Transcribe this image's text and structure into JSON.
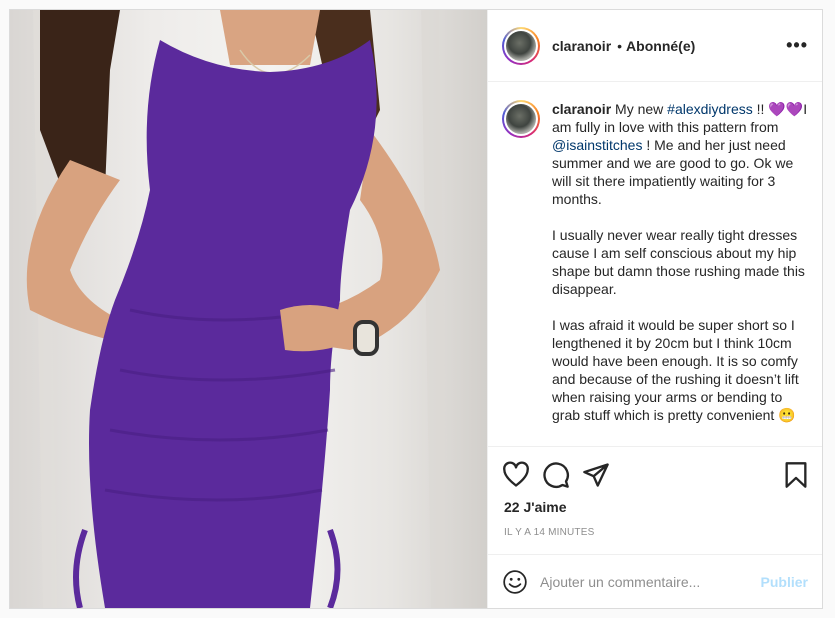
{
  "post": {
    "username": "claranoir",
    "separator": "•",
    "follow_status": "Abonné(e)",
    "more_label": "•••",
    "image_description_icon": "photo-purple-dress"
  },
  "caption": {
    "username": "claranoir",
    "line1_before": " My new ",
    "hashtag": "#alexdiydress",
    "line1_after": " !! 💜💜I am fully in love with this pattern from ",
    "mention": "@isainstitches",
    "line1_end": " ! Me and her just need summer and we are good to go. Ok we will sit there impatiently waiting for 3 months.",
    "para2": "I usually never wear really tight dresses cause I am self conscious about my hip shape but damn those rushing made this disappear.",
    "para3": "I was afraid it would be super short so I lengthened it by 20cm but I think 10cm would have been enough. It is so comfy and because of the rushing it doesn’t lift when raising your arms or bending to grab stuff which is pretty convenient 😬"
  },
  "actions": {
    "likes": "22 J'aime",
    "timestamp": "IL Y A 14 MINUTES"
  },
  "comment_box": {
    "placeholder": "Ajouter un commentaire...",
    "publish_label": "Publier"
  },
  "colors": {
    "link": "#00376b",
    "publish_disabled": "#b2dffc",
    "dress": "#5b2a9c"
  }
}
